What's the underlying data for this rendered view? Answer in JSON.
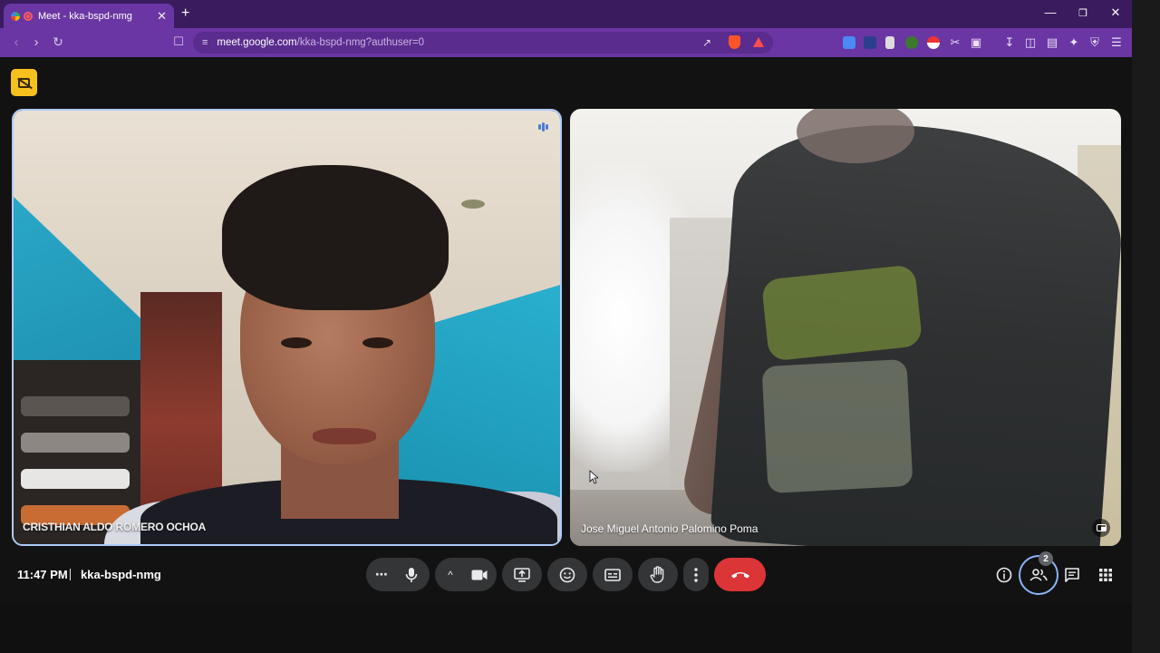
{
  "browser": {
    "tab_title": "Meet - kka-bspd-nmg",
    "tab_close": "✕",
    "new_tab": "+",
    "window_controls": {
      "minimize": "—",
      "maximize": "❐",
      "close": "✕"
    },
    "url_host": "meet.google.com",
    "url_path": "/kka-bspd-nmg?authuser=0",
    "accent": "#6a36a3"
  },
  "meet": {
    "participants": [
      {
        "name": "CRISTHIAN ALDO ROMERO OCHOA",
        "speaking": true
      },
      {
        "name": "Jose Miguel Antonio Palomino Poma",
        "speaking": false
      }
    ],
    "footer": {
      "time": "11:47 PM",
      "meeting_code": "kka-bspd-nmg",
      "people_count": "2"
    },
    "controls": {
      "more_audio": "⋯",
      "caret": "^",
      "end_call_color": "#dc3538",
      "active_ring_color": "#8ab4f8"
    }
  }
}
